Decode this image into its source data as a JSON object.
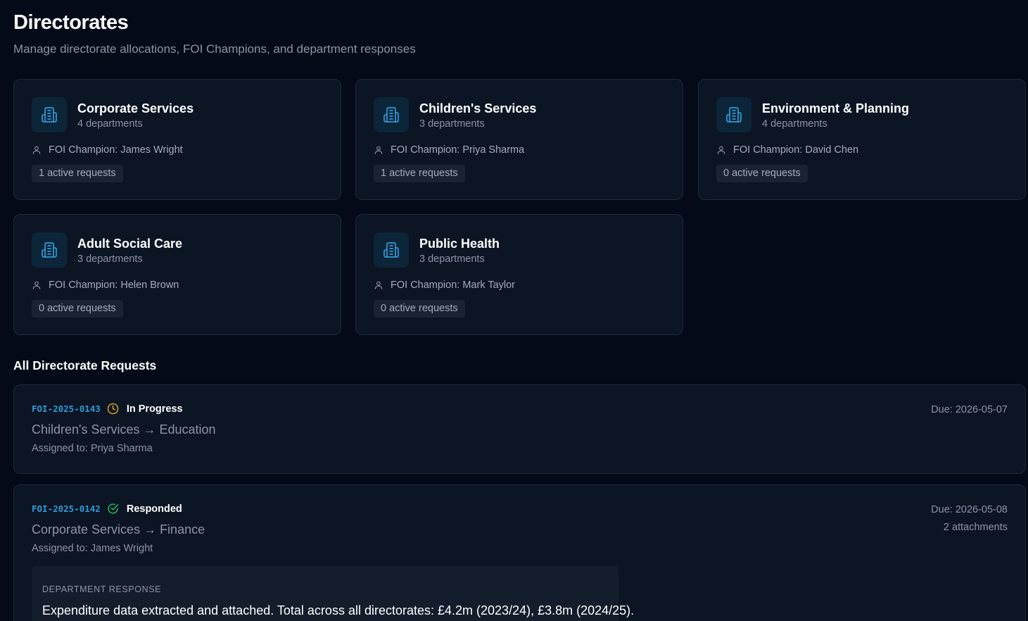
{
  "header": {
    "title": "Directorates",
    "subtitle": "Manage directorate allocations, FOI Champions, and department responses"
  },
  "directorates": [
    {
      "name": "Corporate Services",
      "departments": "4 departments",
      "champion": "FOI Champion: James Wright",
      "active": "1 active requests"
    },
    {
      "name": "Children's Services",
      "departments": "3 departments",
      "champion": "FOI Champion: Priya Sharma",
      "active": "1 active requests"
    },
    {
      "name": "Environment & Planning",
      "departments": "4 departments",
      "champion": "FOI Champion: David Chen",
      "active": "0 active requests"
    },
    {
      "name": "Adult Social Care",
      "departments": "3 departments",
      "champion": "FOI Champion: Helen Brown",
      "active": "0 active requests"
    },
    {
      "name": "Public Health",
      "departments": "3 departments",
      "champion": "FOI Champion: Mark Taylor",
      "active": "0 active requests"
    }
  ],
  "requests_section": {
    "title": "All Directorate Requests"
  },
  "requests": [
    {
      "id": "FOI-2025-0143",
      "status": "In Progress",
      "status_icon": "clock-icon",
      "status_color": "#e0a526",
      "route": "Children's Services → Education",
      "assigned": "Assigned to: Priya Sharma",
      "due": "Due: 2026-05-07"
    },
    {
      "id": "FOI-2025-0142",
      "status": "Responded",
      "status_icon": "check-circle-icon",
      "status_color": "#22c55e",
      "route": "Corporate Services → Finance",
      "assigned": "Assigned to: James Wright",
      "due": "Due: 2026-05-08",
      "attachments": "2 attachments",
      "response_label": "DEPARTMENT RESPONSE",
      "response_text": "Expenditure data extracted and attached. Total across all directorates: £4.2m (2023/24), £3.8m (2024/25)."
    }
  ],
  "theme": {
    "background": "#040a17",
    "card": "#0c1524",
    "accent": "#2f9bd8"
  }
}
